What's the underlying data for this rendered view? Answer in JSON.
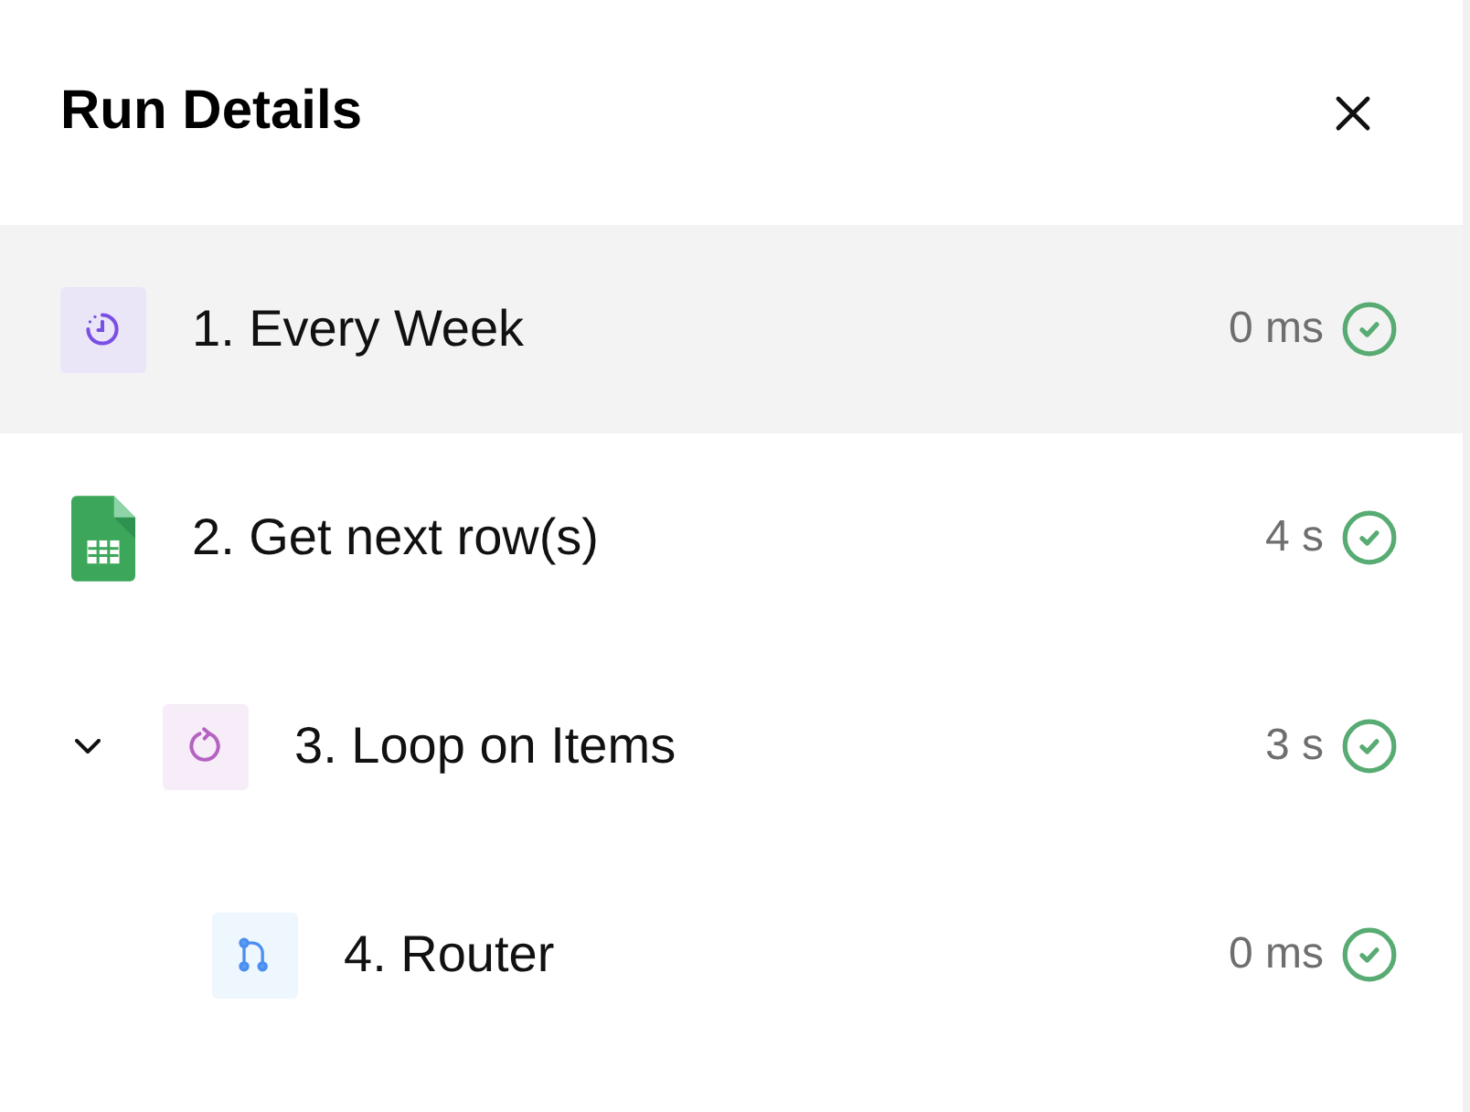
{
  "panel": {
    "title": "Run Details"
  },
  "steps": [
    {
      "label": "1. Every Week",
      "kind": "schedule",
      "duration": "0 ms",
      "succeeded": true,
      "selected": true
    },
    {
      "label": "2. Get next row(s)",
      "kind": "sheet",
      "duration": "4 s",
      "succeeded": true,
      "selected": false
    },
    {
      "label": "3. Loop on Items",
      "kind": "loop",
      "duration": "3 s",
      "succeeded": true,
      "selected": false,
      "expanded": true,
      "children": [
        {
          "label": "4. Router",
          "kind": "router",
          "duration": "0 ms",
          "succeeded": true,
          "selected": false
        }
      ]
    }
  ]
}
